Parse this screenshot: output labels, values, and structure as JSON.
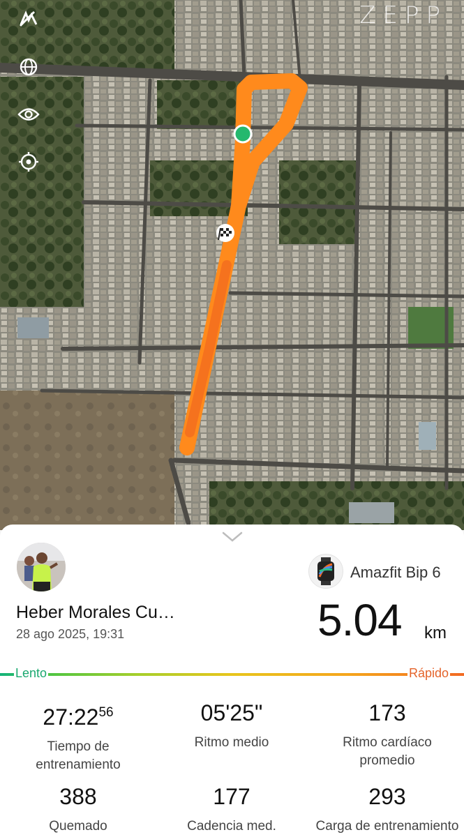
{
  "map": {
    "brand": "ZEPP",
    "tools": [
      {
        "icon": "metric-toggle-icon"
      },
      {
        "icon": "globe-icon"
      },
      {
        "icon": "eye-icon"
      },
      {
        "icon": "locate-icon"
      }
    ],
    "route_color": "#ff8a1c",
    "start_marker_color": "#25b86e"
  },
  "workout": {
    "user_name": "Heber Morales Cu…",
    "date": "28 ago 2025, 19:31",
    "device": "Amazfit Bip 6",
    "distance_value": "5.04",
    "distance_unit": "km",
    "pace_scale": {
      "slow": "Lento",
      "fast": "Rápido"
    },
    "stats": [
      {
        "value": "27:22",
        "value_sup": "56",
        "label_lines": [
          "Tiempo de",
          "entrenamiento"
        ]
      },
      {
        "value": "05'25\"",
        "value_sup": "",
        "label_lines": [
          "Ritmo medio",
          ""
        ]
      },
      {
        "value": "173",
        "value_sup": "",
        "label_lines": [
          "Ritmo cardíaco",
          "promedio"
        ]
      },
      {
        "value": "388",
        "value_sup": "",
        "label_lines": [
          "Quemado",
          ""
        ]
      },
      {
        "value": "177",
        "value_sup": "",
        "label_lines": [
          "Cadencia med.",
          ""
        ]
      },
      {
        "value": "293",
        "value_sup": "",
        "label_lines": [
          "Carga de entrenamiento",
          ""
        ]
      }
    ]
  }
}
